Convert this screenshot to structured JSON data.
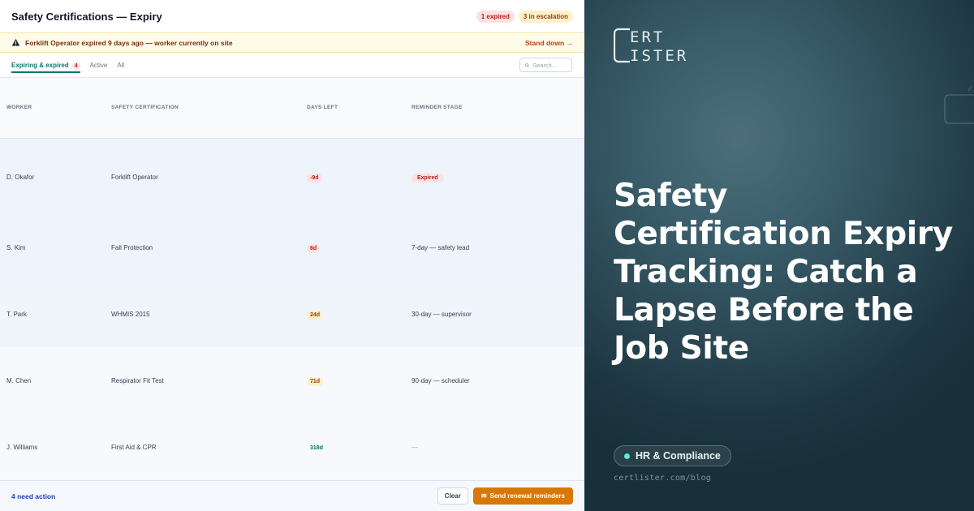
{
  "app": {
    "title": "Safety Certifications — Expiry",
    "badges": {
      "expired": "1 expired",
      "escalation": "3 in escalation"
    }
  },
  "alert": {
    "text": "Forklift Operator expired 9 days ago — worker currently on site",
    "action": "Stand down →",
    "icon": "warning-icon"
  },
  "tabs": [
    {
      "label": "Expiring & expired",
      "count": "4",
      "active": true
    },
    {
      "label": "Active",
      "active": false
    },
    {
      "label": "All",
      "active": false
    }
  ],
  "search": {
    "placeholder": "Search..."
  },
  "table": {
    "headers": [
      "WORKER",
      "SAFETY CERTIFICATION",
      "DAYS LEFT",
      "REMINDER STAGE"
    ],
    "rows": [
      {
        "worker": "D. Okafor",
        "cert": "Forklift Operator",
        "days": "-9d",
        "days_status": "red",
        "stage": "Expired",
        "stage_type": "pill"
      },
      {
        "worker": "S. Kim",
        "cert": "Fall Protection",
        "days": "6d",
        "days_status": "red",
        "stage": "7-day — safety lead",
        "stage_type": "text"
      },
      {
        "worker": "T. Park",
        "cert": "WHMIS 2015",
        "days": "24d",
        "days_status": "amber",
        "stage": "30-day — supervisor",
        "stage_type": "text"
      },
      {
        "worker": "M. Chen",
        "cert": "Respirator Fit Test",
        "days": "71d",
        "days_status": "amber",
        "stage": "90-day — scheduler",
        "stage_type": "text"
      },
      {
        "worker": "J. Williams",
        "cert": "First Aid & CPR",
        "days": "318d",
        "days_status": "green",
        "stage": "—",
        "stage_type": "dash"
      }
    ]
  },
  "footer": {
    "status": "4 need action",
    "clear_label": "Clear",
    "send_label": "Send renewal reminders",
    "send_icon": "mail-icon"
  },
  "promo": {
    "logo_text": "CERTLISTER",
    "headline": "Safety Certification Expiry Tracking: Catch a Lapse Before the Job Site",
    "tag": "HR & Compliance",
    "url": "certlister.com/blog"
  },
  "colors": {
    "accent_teal": "#0f766e",
    "danger": "#b91c1c",
    "warning": "#92400e",
    "cta_orange": "#d97706",
    "promo_bg": "#2a4753"
  }
}
